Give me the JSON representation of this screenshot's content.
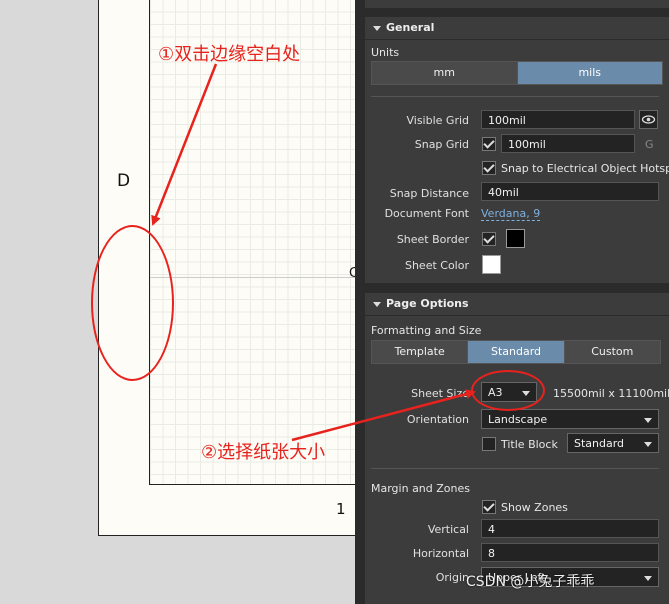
{
  "canvas": {
    "zone_letter": "D",
    "zone_number": "1",
    "zone_letter_partial": "C",
    "annotation_1": "①双击边缘空白处",
    "annotation_2": "②选择纸张大小",
    "annotation_color": "#e8221d"
  },
  "general": {
    "header": "General",
    "units_label": "Units",
    "units_options": [
      "mm",
      "mils"
    ],
    "units_selected": "mils",
    "visible_grid_label": "Visible Grid",
    "visible_grid_value": "100mil",
    "snap_grid_label": "Snap Grid",
    "snap_grid_value": "100mil",
    "snap_grid_shortcut": "G",
    "snap_electrical_label": "Snap to Electrical Object Hotsp",
    "snap_distance_label": "Snap Distance",
    "snap_distance_value": "40mil",
    "document_font_label": "Document Font",
    "document_font_value": "Verdana, 9",
    "sheet_border_label": "Sheet Border",
    "sheet_border_color": "#000000",
    "sheet_color_label": "Sheet Color",
    "sheet_color_value": "#ffffff"
  },
  "page_options": {
    "header": "Page Options",
    "formatting_label": "Formatting and Size",
    "format_tabs": [
      "Template",
      "Standard",
      "Custom"
    ],
    "format_selected": "Standard",
    "sheet_size_label": "Sheet Size",
    "sheet_size_value": "A3",
    "sheet_dimensions": "15500mil  x  11100mil",
    "orientation_label": "Orientation",
    "orientation_value": "Landscape",
    "title_block_label": "Title Block",
    "title_block_value": "Standard",
    "margin_zones_label": "Margin and Zones",
    "show_zones_label": "Show Zones",
    "vertical_label": "Vertical",
    "vertical_value": "4",
    "horizontal_label": "Horizontal",
    "horizontal_value": "8",
    "origin_label": "Origin",
    "origin_value": "Upper Left"
  },
  "watermark": "CSDN @小兔子乖乖",
  "accent_color": "#6a8ba9"
}
